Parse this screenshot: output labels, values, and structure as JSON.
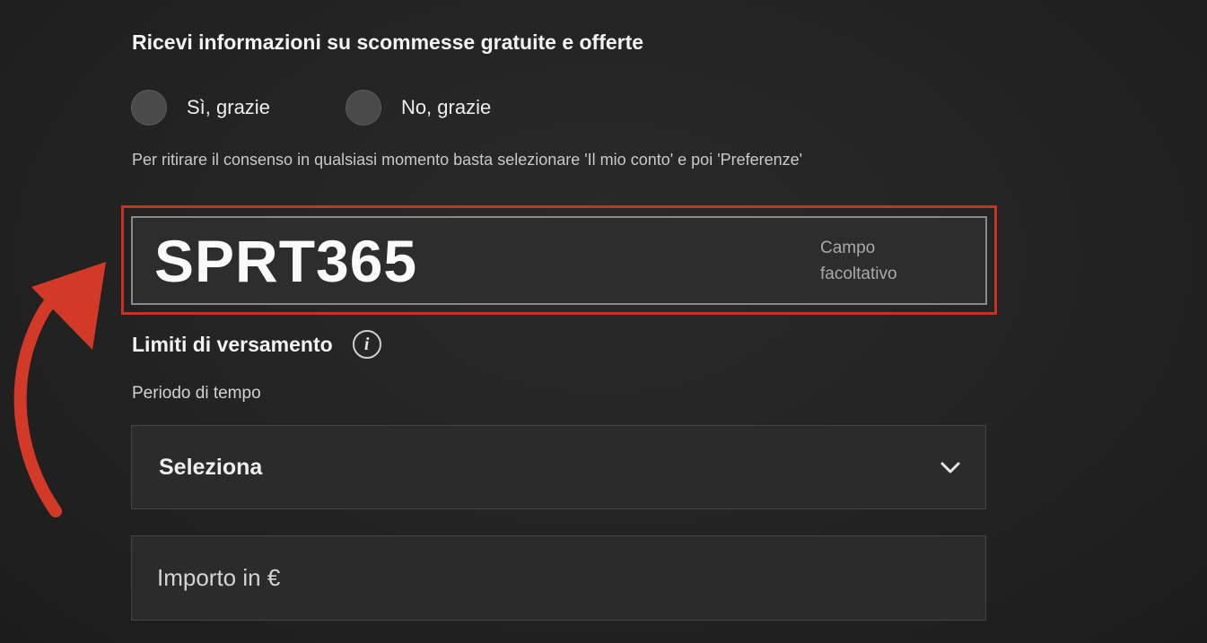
{
  "offers": {
    "heading": "Ricevi informazioni su scommesse gratuite e offerte",
    "options": [
      {
        "label": "Sì, grazie"
      },
      {
        "label": "No, grazie"
      }
    ],
    "consent_note": "Per ritirare il consenso in qualsiasi momento basta selezionare 'Il mio conto' e poi 'Preferenze'"
  },
  "promo_code": {
    "value": "SPRT365",
    "optional_note": "Campo facoltativo"
  },
  "deposit_limits": {
    "title": "Limiti di versamento",
    "info_icon": "info-icon",
    "period_label": "Periodo di tempo",
    "select_value": "Seleziona",
    "amount_placeholder": "Importo in €"
  },
  "colors": {
    "highlight": "#c8321f",
    "arrow": "#d23a27",
    "background": "#232323"
  }
}
